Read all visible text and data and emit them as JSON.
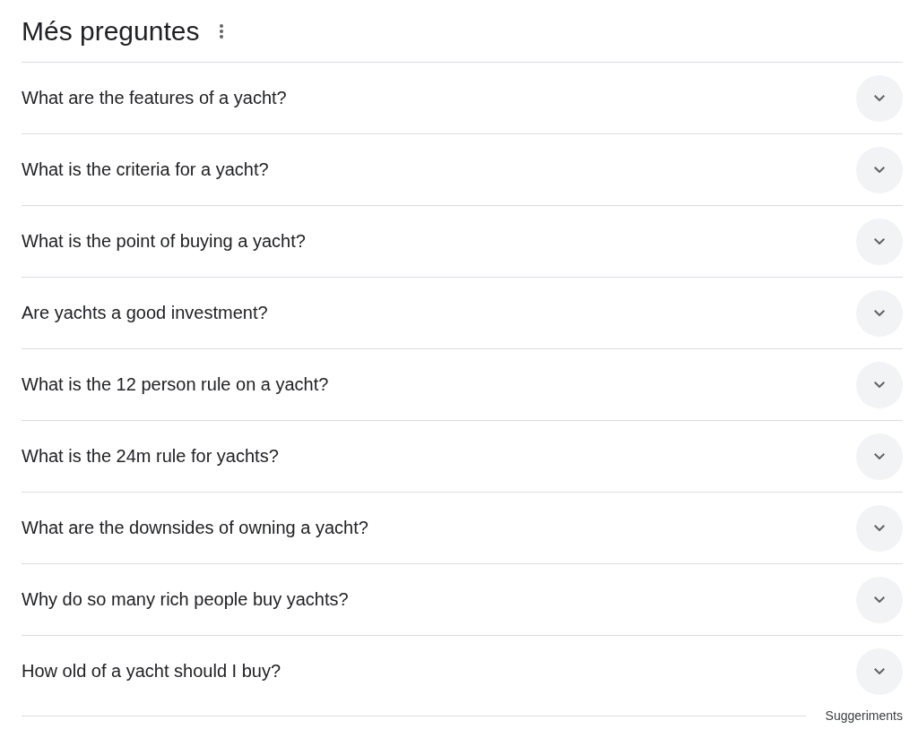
{
  "heading": "Més preguntes",
  "questions": [
    {
      "text": "What are the features of a yacht?",
      "expanded": false
    },
    {
      "text": "What is the criteria for a yacht?",
      "expanded": false
    },
    {
      "text": "What is the point of buying a yacht?",
      "expanded": false
    },
    {
      "text": "Are yachts a good investment?",
      "expanded": false
    },
    {
      "text": "What is the 12 person rule on a yacht?",
      "expanded": false
    },
    {
      "text": "What is the 24m rule for yachts?",
      "expanded": false
    },
    {
      "text": "What are the downsides of owning a yacht?",
      "expanded": false
    },
    {
      "text": "Why do so many rich people buy yachts?",
      "expanded": false
    },
    {
      "text": "How old of a yacht should I buy?",
      "expanded": false
    }
  ],
  "footer": "Suggeriments"
}
